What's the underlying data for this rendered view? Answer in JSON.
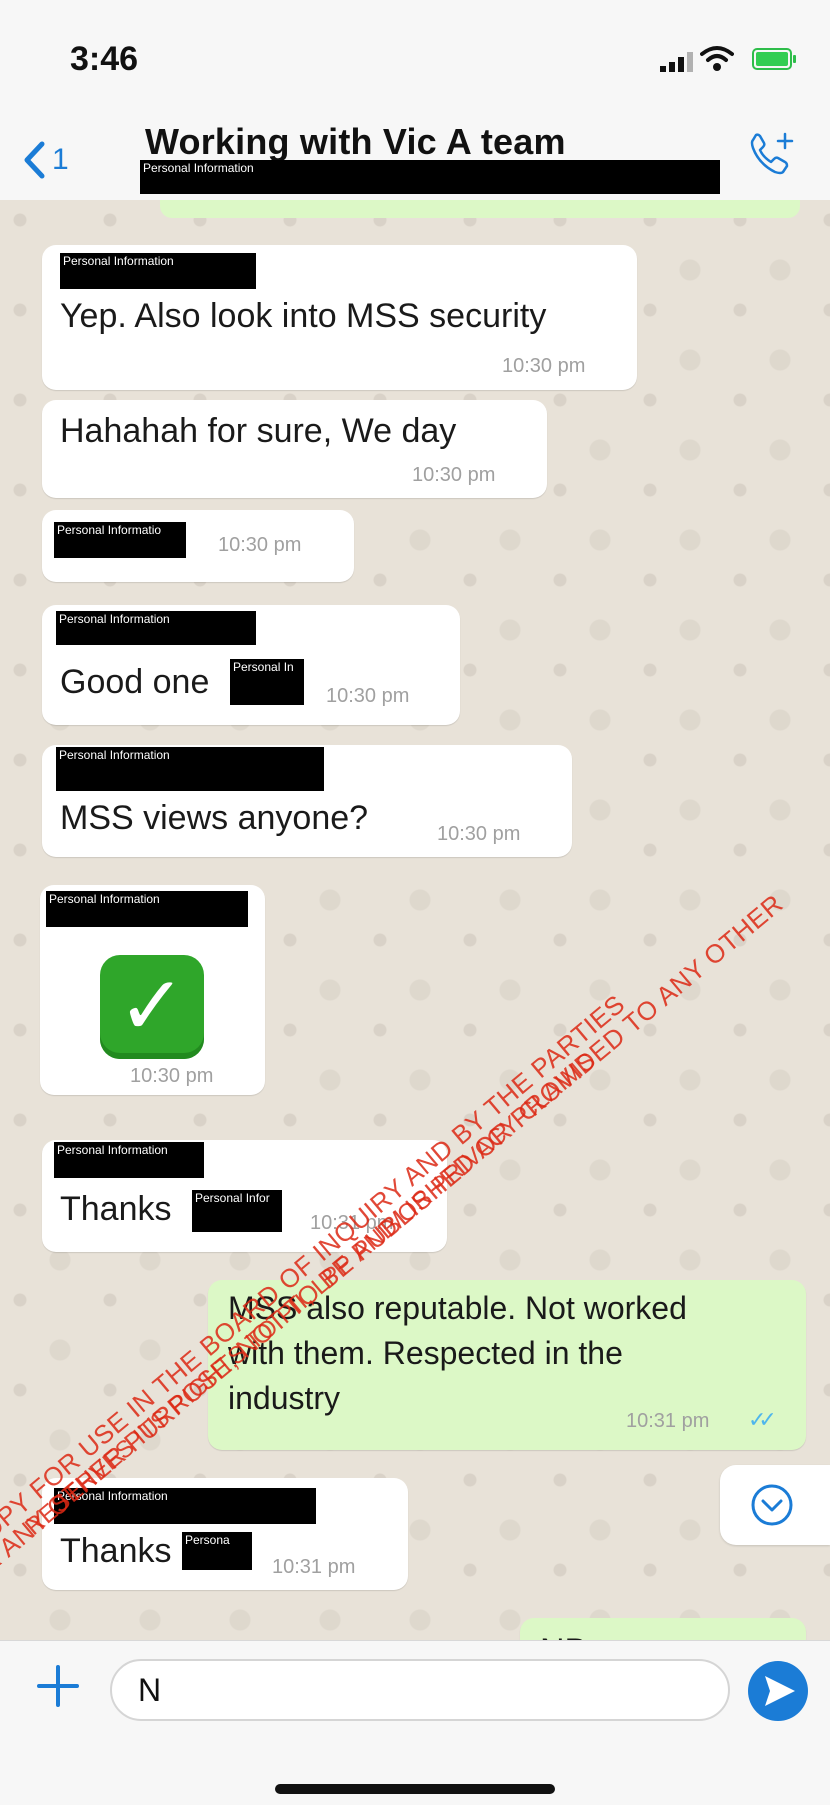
{
  "status_bar": {
    "time": "3:46"
  },
  "header": {
    "back_count": "1",
    "title": "Working with Vic  A team",
    "subtitle_redacted": "Personal Information",
    "call_icon": "add-call-icon"
  },
  "redaction_label": "Personal Information",
  "messages": [
    {
      "sender_redacted": "Personal Information",
      "text": "Yep. Also look into MSS security",
      "time": "10:30 pm"
    },
    {
      "text": "Hahahah for sure, We day",
      "time": "10:30 pm"
    },
    {
      "sender_redacted": "Personal Informatio",
      "time": "10:30 pm"
    },
    {
      "sender_redacted": "Personal Information",
      "text": "Good one",
      "inline_redacted": "Personal In",
      "time": "10:30 pm"
    },
    {
      "sender_redacted": "Personal Information",
      "text": "MSS views anyone?",
      "time": "10:30 pm"
    },
    {
      "sender_redacted": "Personal Information",
      "emoji": "✓",
      "time": "10:30 pm"
    },
    {
      "sender_redacted": "Personal Information",
      "text": "Thanks",
      "inline_redacted": "Personal Infor",
      "time": "10:31 pm"
    },
    {
      "outgoing": true,
      "lines": [
        "MSS also reputable. Not worked",
        "with them. Respected in the",
        "industry"
      ],
      "time": "10:31 pm",
      "ticks": "✓✓"
    },
    {
      "sender_redacted": "Personal Information",
      "text": "Thanks",
      "inline_redacted": "Persona",
      "time": "10:31 pm"
    },
    {
      "outgoing": true,
      "text": "NB"
    }
  ],
  "input": {
    "value": "N"
  },
  "watermark": {
    "lines": [
      "COPY FOR USE IN THE BOARD OF INQUIRY AND BY THE PARTIES",
      "FOR ANY OTHER PURPOSE, NOT TO BE PUBLISHED OR PROVIDED TO ANY OTHER",
      "RESERVES ITS RIGHTS TO PII, LPP AND/OR PRIVACY CLAIMS"
    ]
  },
  "colors": {
    "accent": "#1b7cd6",
    "outgoing_bubble": "#dcf8c6",
    "incoming_bubble": "#ffffff",
    "watermark": "#dc2814"
  }
}
